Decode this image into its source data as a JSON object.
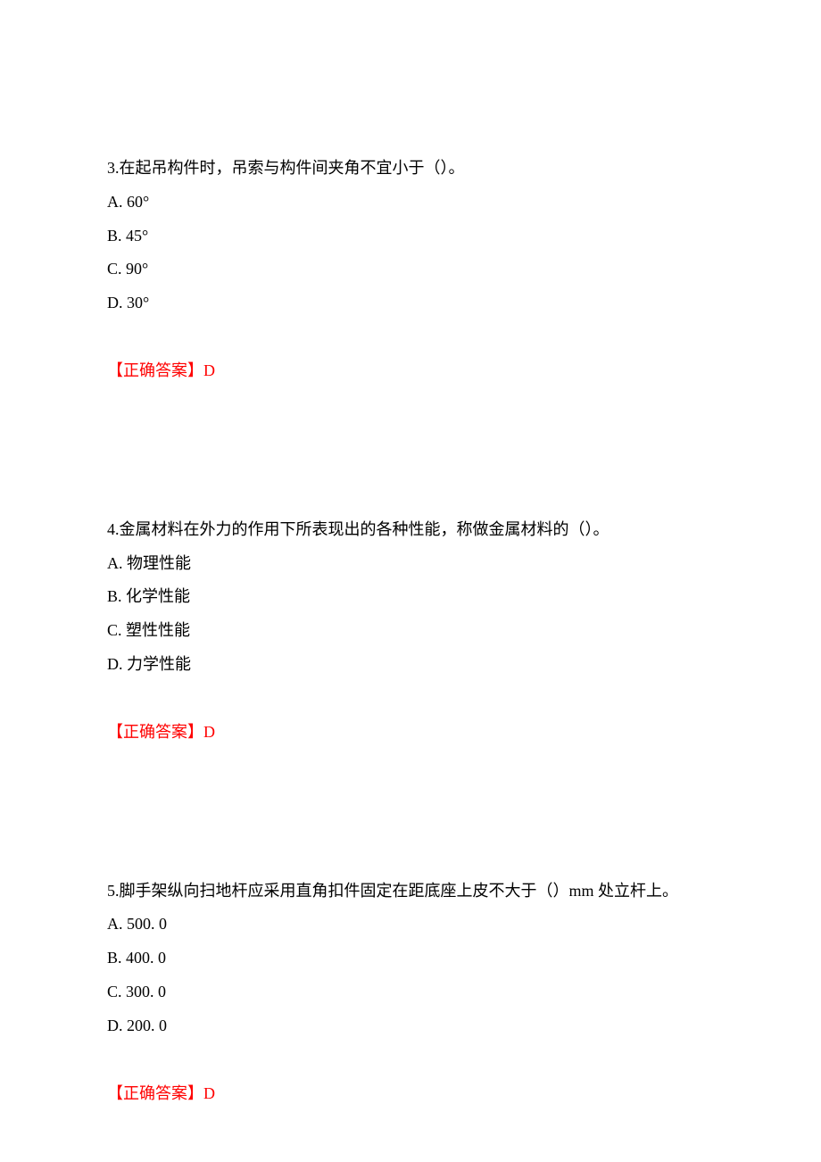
{
  "questions": [
    {
      "number": "3.",
      "text": "在起吊构件时，吊索与构件间夹角不宜小于（）。",
      "options": {
        "a": "A. 60°",
        "b": "B. 45°",
        "c": "C. 90°",
        "d": "D. 30°"
      },
      "answer_label": "【正确答案】",
      "answer_value": "D"
    },
    {
      "number": "4.",
      "text": "金属材料在外力的作用下所表现出的各种性能，称做金属材料的（）。",
      "options": {
        "a": "A. 物理性能",
        "b": "B. 化学性能",
        "c": "C. 塑性性能",
        "d": "D. 力学性能"
      },
      "answer_label": "【正确答案】",
      "answer_value": "D"
    },
    {
      "number": "5.",
      "text": "脚手架纵向扫地杆应采用直角扣件固定在距底座上皮不大于（）mm 处立杆上。",
      "options": {
        "a": "A. 500. 0",
        "b": "B. 400. 0",
        "c": "C. 300. 0",
        "d": "D. 200. 0"
      },
      "answer_label": "【正确答案】",
      "answer_value": "D"
    }
  ]
}
